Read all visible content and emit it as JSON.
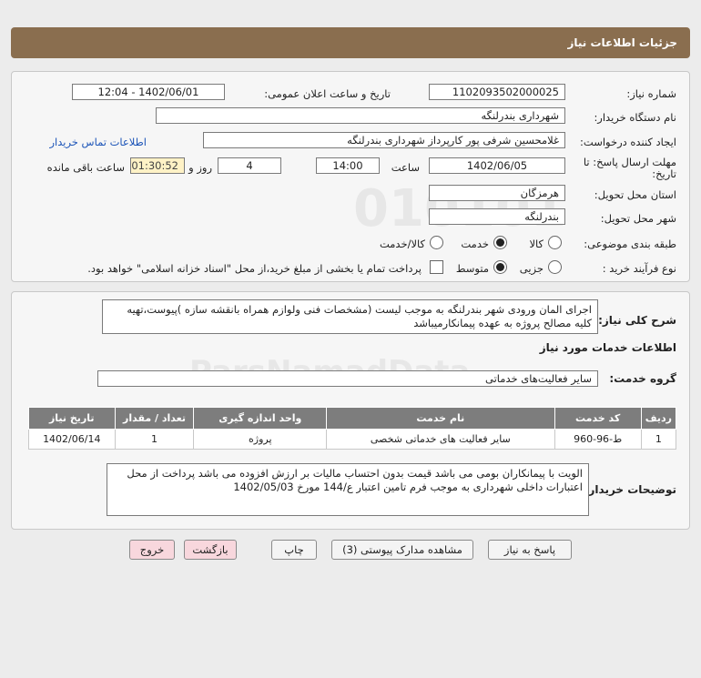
{
  "header": {
    "title": "جزئیات اطلاعات نیاز"
  },
  "form": {
    "need_number_label": "شماره نیاز:",
    "need_number": "1102093502000025",
    "announce_label": "تاریخ و ساعت اعلان عمومی:",
    "announce_value": "1402/06/01 - 12:04",
    "buyer_org_label": "نام دستگاه خریدار:",
    "buyer_org": "شهرداری بندرلنگه",
    "creator_label": "ایجاد کننده درخواست:",
    "creator": "غلامحسین شرفی پور کارپرداز شهرداری بندرلنگه",
    "contact_link": "اطلاعات تماس خریدار",
    "deadline_label_1": "مهلت ارسال پاسخ: تا",
    "deadline_label_2": "تاریخ:",
    "deadline_date": "1402/06/05",
    "time_label": "ساعت",
    "deadline_time": "14:00",
    "days_value": "4",
    "days_label": "روز و",
    "remaining_time": "01:30:52",
    "remaining_label": "ساعت باقی مانده",
    "province_label": "استان محل تحویل:",
    "province": "هرمزگان",
    "city_label": "شهر محل تحویل:",
    "city": "بندرلنگه",
    "category_label": "طبقه بندی موضوعی:",
    "category_options": [
      "کالا",
      "خدمت",
      "کالا/خدمت"
    ],
    "category_selected": 1,
    "process_label": "نوع فرآیند خرید :",
    "process_options": [
      "جزیی",
      "متوسط"
    ],
    "process_selected": 1,
    "payment_note": "پرداخت تمام یا بخشی از مبلغ خرید،از محل \"اسناد خزانه اسلامی\" خواهد بود."
  },
  "description": {
    "label": "شرح کلی نیاز:",
    "text": "اجرای المان ورودی شهر بندرلنگه به موجب لیست (مشخصات فنی ولوازم همراه بانقشه سازه )پیوست،تهیه کلیه مصالح پروژه به عهده پیمانکارمیباشد"
  },
  "services": {
    "section_title": "اطلاعات خدمات مورد نیاز",
    "group_label": "گروه خدمت:",
    "group_value": "سایر فعالیت‌های خدماتی",
    "table": {
      "headers": [
        "ردیف",
        "کد خدمت",
        "نام خدمت",
        "واحد اندازه گیری",
        "تعداد / مقدار",
        "تاریخ نیاز"
      ],
      "rows": [
        [
          "1",
          "ط-96-960",
          "سایر فعالیت های خدماتی شخصی",
          "پروژه",
          "1",
          "1402/06/14"
        ]
      ]
    }
  },
  "buyer_notes": {
    "label": "توضیحات خریدار:",
    "text": "الویت با پیمانکاران بومی می باشد قیمت بدون احتساب مالیات بر ارزش افزوده می باشد پرداخت از محل اعتبارات داخلی شهرداری به موجب فرم تامین اعتبار ع/144 مورخ 1402/05/03"
  },
  "buttons": {
    "reply": "پاسخ به نیاز",
    "view_docs": "مشاهده مدارک پیوستی (3)",
    "print": "چاپ",
    "back": "بازگشت",
    "exit": "خروج"
  },
  "colors": {
    "header_bg": "#8a6e4f",
    "link": "#1d55b8",
    "time_bg": "#fff2c6",
    "table_header": "#7d7d7d"
  }
}
